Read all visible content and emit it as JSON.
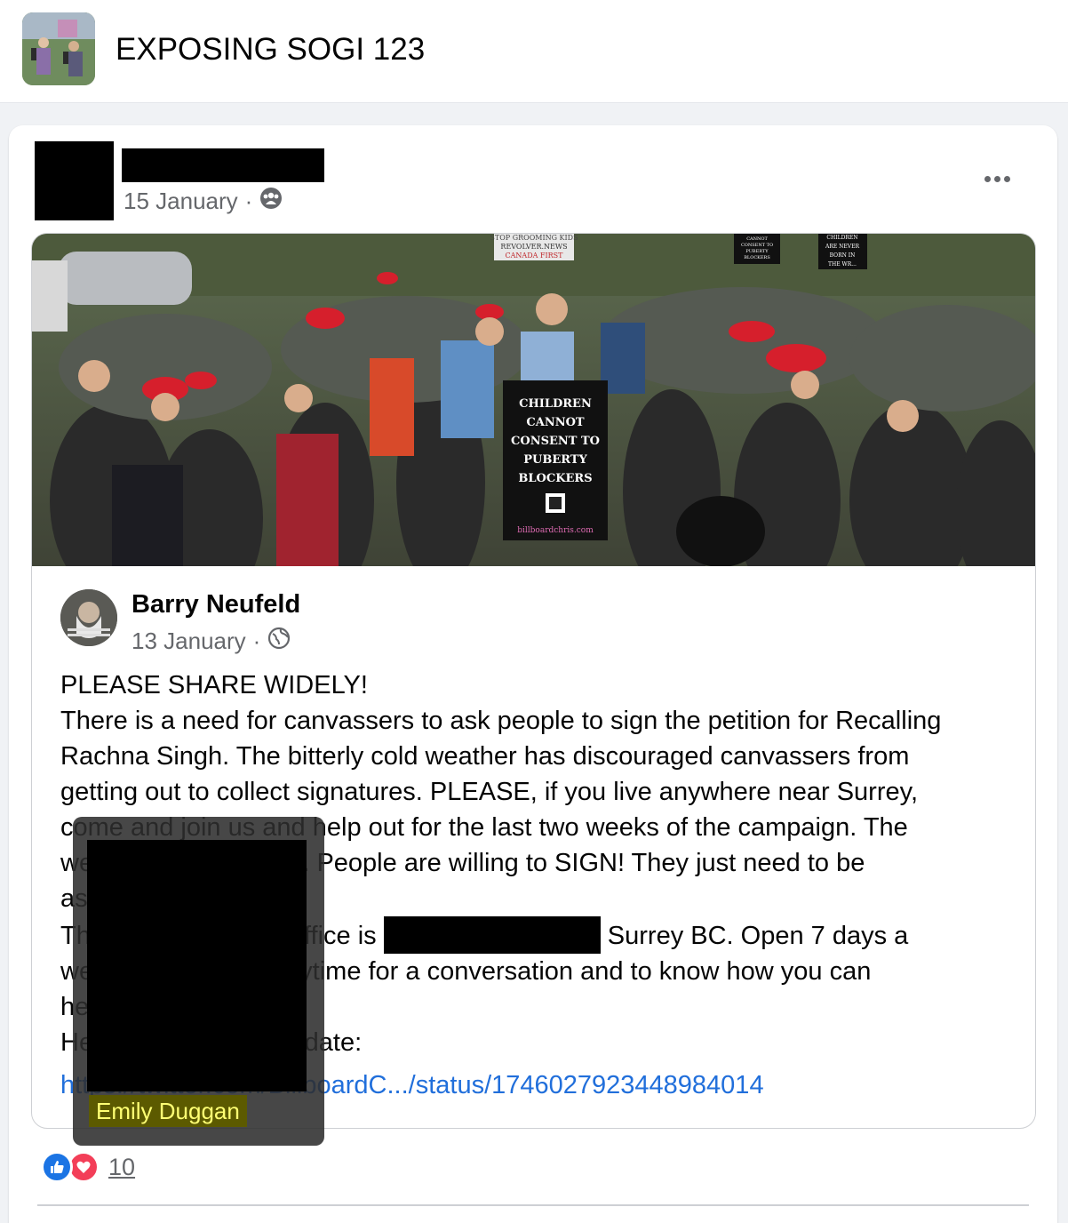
{
  "group": {
    "name": "EXPOSING SOGI 123"
  },
  "post": {
    "date": "15 January",
    "separator": "·",
    "audience_icon": "group-icon"
  },
  "photo_sign": {
    "lines": [
      "CHILDREN",
      "CANNOT",
      "CONSENT TO",
      "PUBERTY",
      "BLOCKERS"
    ],
    "website": "billboardchris.com",
    "top_sign": [
      "STOP GROOMING KIDS",
      "REVOLVER.NEWS",
      "CANADA FIRST"
    ],
    "right_sign": [
      "CHILDREN",
      "ARE NEVER",
      "BORN IN",
      "THE WR..."
    ],
    "left_sign": [
      "CANNOT",
      "CONSENT TO",
      "PUBERTY",
      "BLOCKERS"
    ]
  },
  "shared": {
    "author": "Barry Neufeld",
    "date": "13 January",
    "separator": "·",
    "audience_icon": "globe-icon",
    "lines": [
      "PLEASE SHARE WIDELY!",
      "There is a need for canvassers to ask people to sign the petition for Recalling",
      "Rachna Singh. The bitterly cold weather has discouraged canvassers from",
      "getting out to collect signatures. PLEASE, if you live anywhere near Surrey,",
      "come and join us and help out for the last two weeks of the campaign. The",
      "we                    armer. People are willing to SIGN! They just need to be",
      "as",
      "Th                    ingh office is",
      "we                    by anytime for a conversation and to know how you can",
      "he",
      "He                    ris' update:"
    ],
    "address_tail": "Surrey BC. Open 7 days a",
    "link": "https://twitter.com/BillboardC.../status/1746027923448984014"
  },
  "tooltip": {
    "name": "Emily Duggan"
  },
  "reactions": {
    "count": "10",
    "types": [
      "like-icon",
      "love-icon"
    ]
  },
  "colors": {
    "link": "#216fdb",
    "like": "#1b74e4",
    "love": "#f33e58",
    "meta": "#65676b"
  }
}
